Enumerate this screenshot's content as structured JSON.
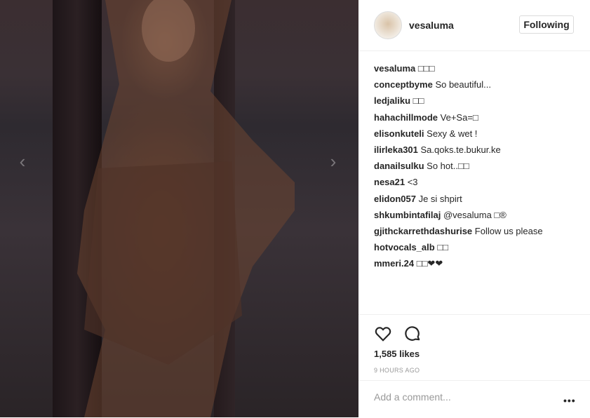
{
  "post": {
    "username": "vesaluma",
    "follow_label": "Following",
    "comments": [
      {
        "user": "vesaluma",
        "text": "□□□"
      },
      {
        "user": "conceptbyme",
        "text": "So beautiful..."
      },
      {
        "user": "ledjaliku",
        "text": "□□"
      },
      {
        "user": "hahachillmode",
        "text": "Ve+Sa=□"
      },
      {
        "user": "elisonkuteli",
        "text": "Sexy & wet !"
      },
      {
        "user": "ilirleka301",
        "text": "Sa.qoks.te.bukur.ke"
      },
      {
        "user": "danailsulku",
        "text": "So hot..□□"
      },
      {
        "user": "nesa21",
        "text": "<3"
      },
      {
        "user": "elidon057",
        "text": "Je si shpirt"
      },
      {
        "user": "shkumbintafilaj",
        "text": "@vesaluma □®"
      },
      {
        "user": "gjithckarrethdashurise",
        "text": "Follow us please"
      },
      {
        "user": "hotvocals_alb",
        "text": "□□"
      },
      {
        "user": "mmeri.24",
        "text": "□□❤❤"
      }
    ],
    "likes": "1,585 likes",
    "time": "9 HOURS AGO",
    "add_comment_placeholder": "Add a comment...",
    "more_label": "•••"
  },
  "icons": {
    "like": "heart-icon",
    "comment": "comment-icon",
    "prev": "chevron-left-icon",
    "next": "chevron-right-icon"
  }
}
